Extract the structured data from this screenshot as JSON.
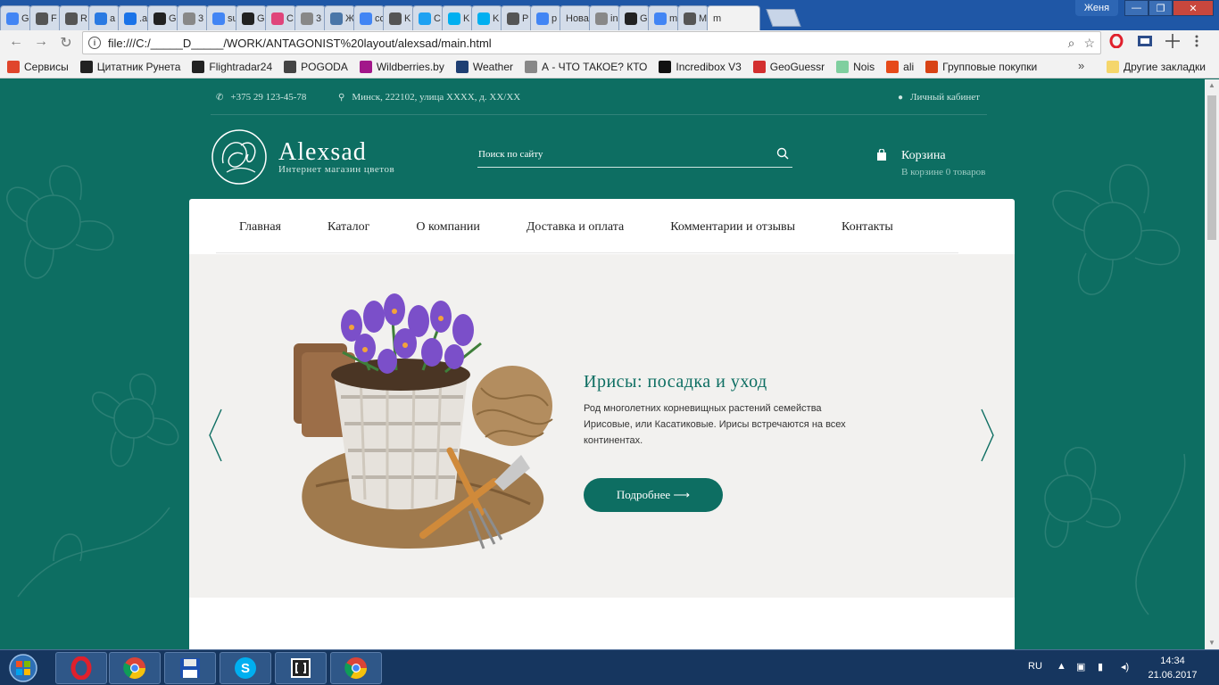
{
  "browser": {
    "tabs": [
      {
        "icon": "google-icon",
        "label": "G",
        "color": "#4285f4"
      },
      {
        "icon": "codepen-icon",
        "label": "F",
        "color": "#555"
      },
      {
        "icon": "codepen-icon",
        "label": "R",
        "color": "#555"
      },
      {
        "icon": "picture-icon",
        "label": "a",
        "color": "#2a7ae2"
      },
      {
        "icon": "wave-icon",
        "label": ".a",
        "color": "#1a73e8"
      },
      {
        "icon": "github-icon",
        "label": "G",
        "color": "#222"
      },
      {
        "icon": "doc-icon",
        "label": "3",
        "color": "#888"
      },
      {
        "icon": "google-icon",
        "label": "su",
        "color": "#4285f4"
      },
      {
        "icon": "github-icon",
        "label": "G",
        "color": "#222"
      },
      {
        "icon": "m-icon",
        "label": "C",
        "color": "#e0457b"
      },
      {
        "icon": "doc-icon",
        "label": "3",
        "color": "#888"
      },
      {
        "icon": "vk-icon",
        "label": "Ж",
        "color": "#4a76a8"
      },
      {
        "icon": "google-icon",
        "label": "cc",
        "color": "#4285f4"
      },
      {
        "icon": "opera-ext-icon",
        "label": "K",
        "color": "#555"
      },
      {
        "icon": "gear-icon",
        "label": "C",
        "color": "#1da1f2"
      },
      {
        "icon": "skype-icon",
        "label": "K",
        "color": "#00aff0"
      },
      {
        "icon": "skype-icon",
        "label": "K",
        "color": "#00aff0"
      },
      {
        "icon": "codepen-icon",
        "label": "P",
        "color": "#555"
      },
      {
        "icon": "google-icon",
        "label": "p",
        "color": "#4285f4"
      },
      {
        "icon": "none",
        "label": "Нова",
        "color": "#888"
      },
      {
        "icon": "doc-icon",
        "label": "in",
        "color": "#888"
      },
      {
        "icon": "github-icon",
        "label": "G",
        "color": "#222"
      },
      {
        "icon": "google-icon",
        "label": "m",
        "color": "#4285f4"
      },
      {
        "icon": "codepen-icon",
        "label": "M",
        "color": "#555"
      },
      {
        "icon": "none",
        "label": "m",
        "color": "#888",
        "active": true
      }
    ],
    "profile": "Женя",
    "window_buttons": {
      "minimize": "—",
      "maximize": "❐",
      "close": "✕"
    },
    "url": "file:///C:/_____D_____/WORK/ANTAGONIST%20layout/alexsad/main.html",
    "bookmarks": [
      {
        "label": "Сервисы",
        "icon": "apps-icon",
        "color": "#e0452c"
      },
      {
        "label": "Цитатник Рунета",
        "icon": "b-icon",
        "color": "#222"
      },
      {
        "label": "Flightradar24",
        "icon": "radar-icon",
        "color": "#222"
      },
      {
        "label": "POGODA",
        "icon": "weather-small-icon",
        "color": "#444"
      },
      {
        "label": "Wildberries.by",
        "icon": "w-icon",
        "color": "#a2178a"
      },
      {
        "label": "Weather",
        "icon": "weather-icon",
        "color": "#1e3f73"
      },
      {
        "label": "А - ЧТО ТАКОЕ? КТО",
        "icon": "doc-icon",
        "color": "#888"
      },
      {
        "label": "Incredibox V3",
        "icon": "music-icon",
        "color": "#111"
      },
      {
        "label": "GeoGuessr",
        "icon": "map-pin-icon",
        "color": "#d32f2f"
      },
      {
        "label": "Nois",
        "icon": "nois-icon",
        "color": "#7fcf9f"
      },
      {
        "label": "ali",
        "icon": "ali-icon",
        "color": "#e64a19"
      },
      {
        "label": "Групповые покупки",
        "icon": "group-icon",
        "color": "#d84315"
      }
    ],
    "bookmarks_more": "»",
    "other_bookmarks": "Другие закладки"
  },
  "site": {
    "phone": "+375 29 123-45-78",
    "address": "Минск, 222102, улица ХХХХ, д. ХХ/ХХ",
    "account": "Личный кабинет",
    "brand": "Alexsad",
    "brand_sub": "Интернет магазин цветов",
    "search_placeholder": "Поиск по сайту",
    "cart_title": "Корзина",
    "cart_status": "В корзине 0 товаров",
    "nav": [
      "Главная",
      "Каталог",
      "О компании",
      "Доставка и оплата",
      "Комментарии и отзывы",
      "Контакты"
    ],
    "slide": {
      "title": "Ирисы: посадка и уход",
      "text": "Род многолетних корневищных растений семейства Ирисовые, или Касатиковые. Ирисы встречаются на всех континентах.",
      "button": "Подробнее ⟶"
    }
  },
  "taskbar": {
    "apps": [
      "opera-icon",
      "chrome-icon",
      "floppy-icon",
      "skype-icon",
      "brackets-icon",
      "chrome-icon"
    ],
    "lang": "RU",
    "time": "14:34",
    "date": "21.06.2017"
  },
  "colors": {
    "brand_green": "#0d6e62",
    "slide_bg": "#f2f1ef"
  }
}
